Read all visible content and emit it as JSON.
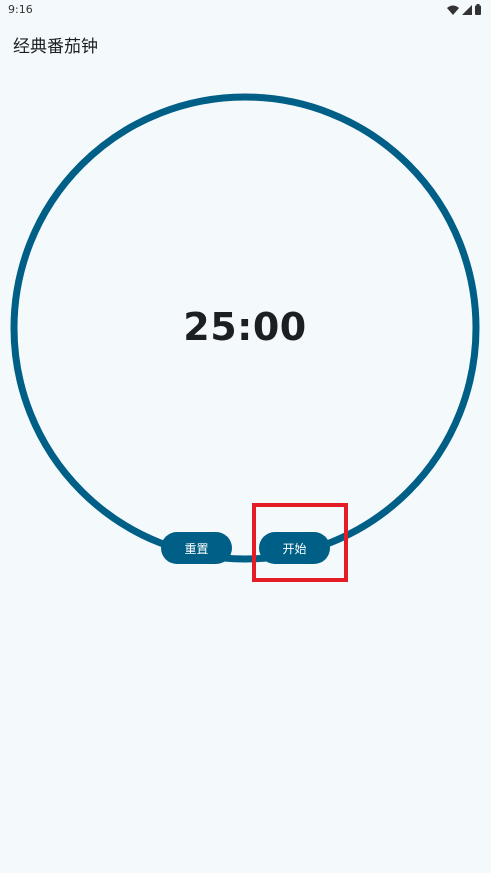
{
  "status_bar": {
    "time": "9:16",
    "icons": [
      "wifi-icon",
      "signal-icon",
      "battery-icon"
    ]
  },
  "app": {
    "title": "经典番茄钟"
  },
  "timer": {
    "display": "25:00",
    "ring_color": "#005f86"
  },
  "controls": {
    "reset_label": "重置",
    "start_label": "开始",
    "button_color": "#005f86"
  },
  "annotation": {
    "highlight_color": "#e31c25",
    "highlighted_control": "start"
  }
}
